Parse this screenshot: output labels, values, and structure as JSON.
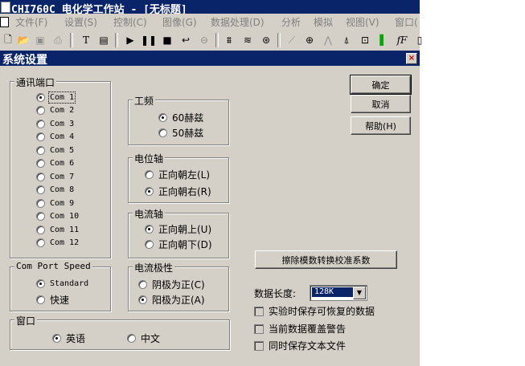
{
  "app": {
    "title": "CHI760C 电化学工作站 - [无标题]",
    "menu": [
      "文件(F)",
      "设置(S)",
      "控制(C)",
      "图像(G)",
      "数据处理(D)",
      "分析",
      "模拟",
      "视图(V)",
      "窗口("
    ]
  },
  "toolbar": {
    "icons": [
      "new-file-icon",
      "open-folder-icon",
      "save-icon",
      "print-icon",
      "text-icon",
      "page-icon",
      "run-icon",
      "pause-icon",
      "stop-icon",
      "reverse-icon",
      "cell-icon",
      "graph-icon",
      "smooth-icon",
      "zoom-icon",
      "peak-icon",
      "hist-icon",
      "special-icon",
      "cv-icon",
      "color-icon",
      "font-icon",
      "extra-icon"
    ]
  },
  "dialog": {
    "title": "系统设置",
    "close_glyph": "×",
    "buttons": {
      "ok": "确定",
      "cancel": "取消",
      "help": "帮助(H)"
    },
    "comm_port": {
      "legend": "通讯端口",
      "options": [
        "Com 1",
        "Com 2",
        "Com 3",
        "Com 4",
        "Com 5",
        "Com 6",
        "Com 7",
        "Com 8",
        "Com 9",
        "Com 10",
        "Com 11",
        "Com 12"
      ],
      "selected": "Com 1"
    },
    "freq": {
      "legend": "工频",
      "options": [
        "60赫兹",
        "50赫兹"
      ],
      "selected": "60赫兹"
    },
    "potential_axis": {
      "legend": "电位轴",
      "options": [
        "正向朝左(L)",
        "正向朝右(R)"
      ],
      "selected": "正向朝右(R)"
    },
    "current_axis": {
      "legend": "电流轴",
      "options": [
        "正向朝上(U)",
        "正向朝下(D)"
      ],
      "selected": "正向朝上(U)"
    },
    "current_polarity": {
      "legend": "电流极性",
      "options": [
        "阴极为正(C)",
        "阳极为正(A)"
      ],
      "selected": "阳极为正(A)"
    },
    "com_port_speed": {
      "legend": "Com Port Speed",
      "options": [
        "Standard",
        "快速"
      ],
      "selected": "Standard"
    },
    "window": {
      "legend": "窗口",
      "options": [
        "英语",
        "中文"
      ],
      "selected": "英语"
    },
    "clear_button": "擦除模数转换校准系数",
    "data_length": {
      "label": "数据长度:",
      "value": "128K"
    },
    "checkboxes": [
      "实验时保存可恢复的数据",
      "当前数据覆盖警告",
      "同时保存文本文件"
    ]
  }
}
